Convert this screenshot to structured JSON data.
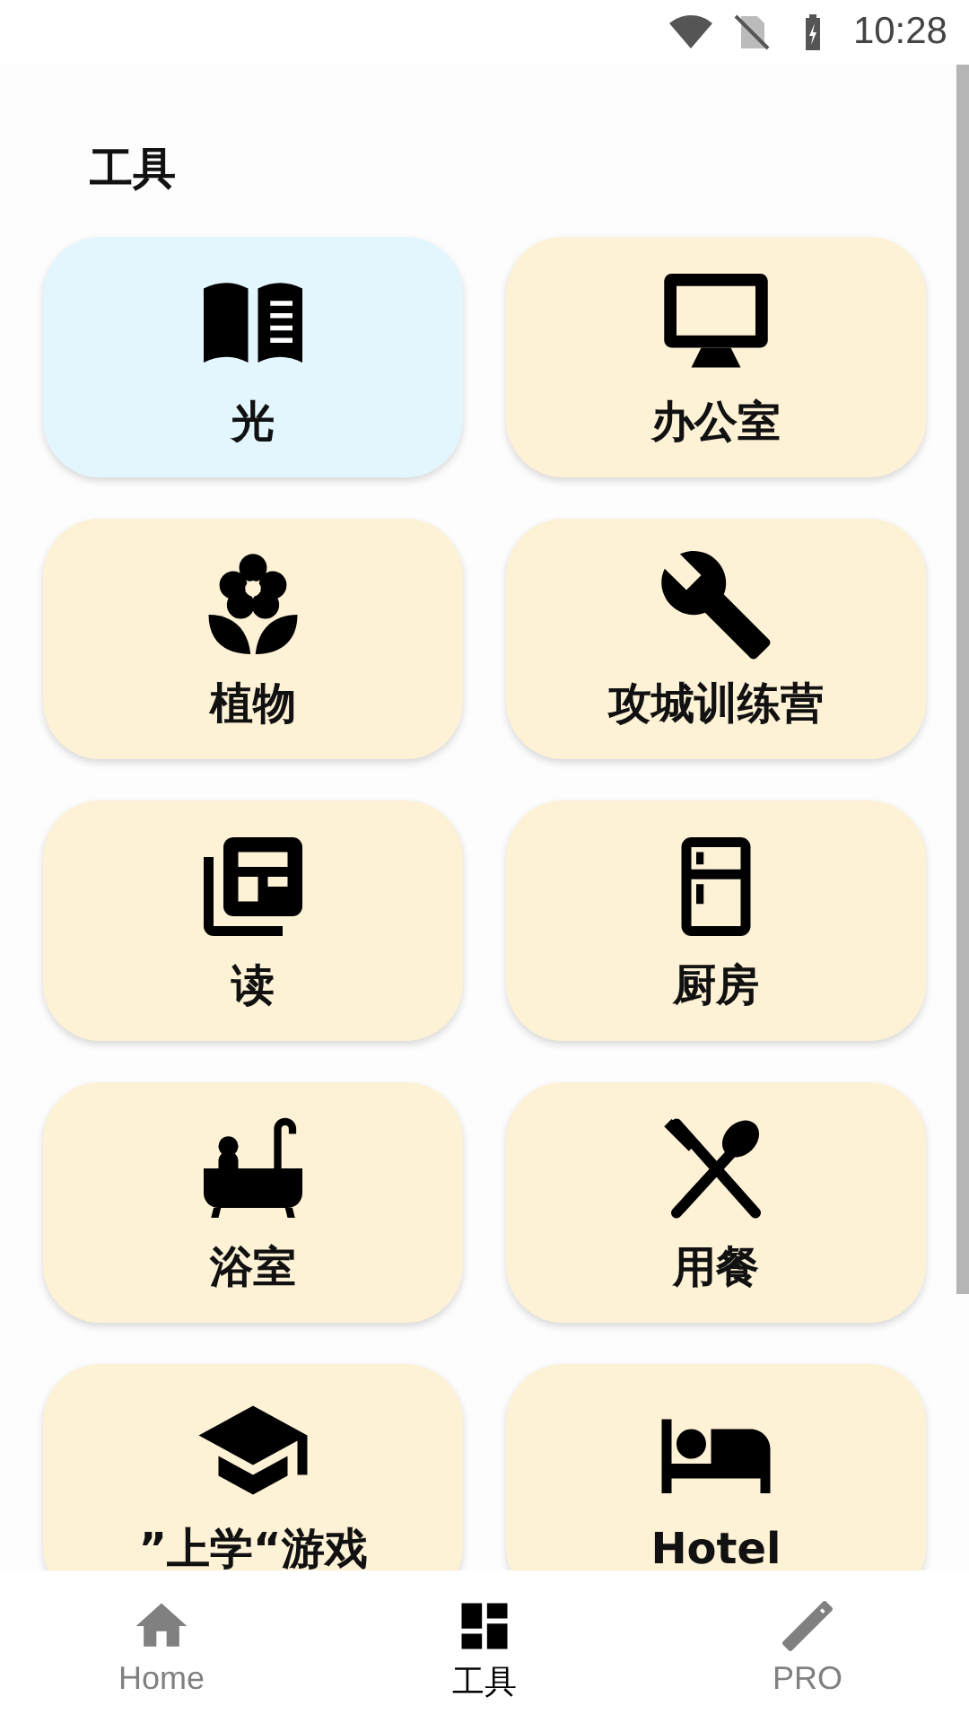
{
  "status_bar": {
    "time": "10:28"
  },
  "title": "工具",
  "cards": [
    {
      "label": "光",
      "selected": true
    },
    {
      "label": "办公室",
      "selected": false
    },
    {
      "label": "植物",
      "selected": false
    },
    {
      "label": "攻城训练营",
      "selected": false
    },
    {
      "label": "读",
      "selected": false
    },
    {
      "label": "厨房",
      "selected": false
    },
    {
      "label": "浴室",
      "selected": false
    },
    {
      "label": "用餐",
      "selected": false
    },
    {
      "label": "”上学“游戏",
      "selected": false
    },
    {
      "label": "Hotel",
      "selected": false
    }
  ],
  "bottom_nav": [
    {
      "label": "Home",
      "selected": false
    },
    {
      "label": "工具",
      "selected": true
    },
    {
      "label": "PRO",
      "selected": false
    }
  ]
}
